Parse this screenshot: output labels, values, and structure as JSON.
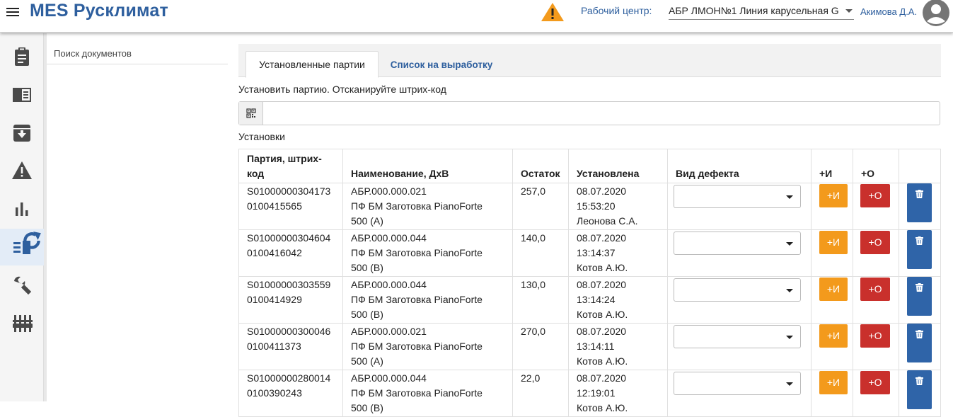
{
  "header": {
    "app_title": "MES Русклимат",
    "workcenter_label": "Рабочий центр:",
    "workcenter_value": "АБР ЛМОН№1 Линия карусельная G",
    "user_name": "Акимова Д.А."
  },
  "rail": {
    "items": [
      {
        "icon": "clipboard-icon"
      },
      {
        "icon": "book-panel-icon"
      },
      {
        "icon": "archive-download-icon"
      },
      {
        "icon": "warning-icon"
      },
      {
        "icon": "bar-chart-icon"
      },
      {
        "icon": "list-panel-icon",
        "active": true,
        "badge": "refresh-icon"
      },
      {
        "icon": "wrench-icon"
      },
      {
        "icon": "sliders-icon"
      }
    ]
  },
  "search": {
    "label": "Поиск документов"
  },
  "tabs": [
    {
      "label": "Установленные партии",
      "active": true
    },
    {
      "label": "Список на выработку",
      "active": false
    }
  ],
  "scan": {
    "label": "Установить партию. Отсканируйте штрих-код",
    "value": "",
    "placeholder": ""
  },
  "installs": {
    "label": "Установки",
    "columns": {
      "batch": "Партия, штрих-код",
      "name": "Наименование, ДхВ",
      "remain": "Остаток",
      "installed": "Установлена",
      "defect": "Вид дефекта",
      "plus_i": "+И",
      "plus_o": "+О",
      "del": ""
    },
    "buttons": {
      "plus_i": "+И",
      "plus_o": "+О"
    },
    "rows": [
      {
        "batch_1": "S01000000304173",
        "batch_2": "0100415565",
        "name_1": "АБР.000.000.021",
        "name_2": "ПФ БМ Заготовка PianoForte",
        "name_3": "500 (A)",
        "remain": "257,0",
        "date": "08.07.2020",
        "time": "15:53:20",
        "user": "Леонова С.А.",
        "defect": ""
      },
      {
        "batch_1": "S01000000304604",
        "batch_2": "0100416042",
        "name_1": "АБР.000.000.044",
        "name_2": "ПФ БМ Заготовка PianoForte",
        "name_3": "500 (B)",
        "remain": "140,0",
        "date": "08.07.2020",
        "time": "13:14:37",
        "user": "Котов А.Ю.",
        "defect": ""
      },
      {
        "batch_1": "S01000000303559",
        "batch_2": "0100414929",
        "name_1": "АБР.000.000.044",
        "name_2": "ПФ БМ Заготовка PianoForte",
        "name_3": "500 (B)",
        "remain": "130,0",
        "date": "08.07.2020",
        "time": "13:14:24",
        "user": "Котов А.Ю.",
        "defect": ""
      },
      {
        "batch_1": "S01000000300046",
        "batch_2": "0100411373",
        "name_1": "АБР.000.000.021",
        "name_2": "ПФ БМ Заготовка PianoForte",
        "name_3": "500 (A)",
        "remain": "270,0",
        "date": "08.07.2020",
        "time": "13:14:11",
        "user": "Котов А.Ю.",
        "defect": ""
      },
      {
        "batch_1": "S01000000280014",
        "batch_2": "0100390243",
        "name_1": "АБР.000.000.044",
        "name_2": "ПФ БМ Заготовка PianoForte",
        "name_3": "500 (B)",
        "remain": "22,0",
        "date": "08.07.2020",
        "time": "12:19:01",
        "user": "Котов А.Ю.",
        "defect": ""
      }
    ]
  },
  "colors": {
    "brand": "#2e5f9e",
    "warning": "#f39a1c",
    "danger": "#c9302c",
    "primary": "#2f64a8"
  }
}
